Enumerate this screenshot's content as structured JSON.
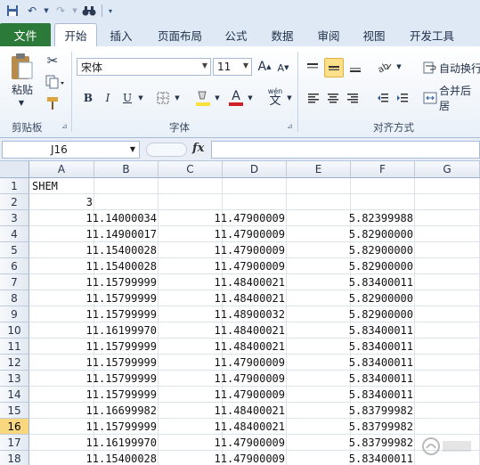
{
  "qat": {
    "items": [
      "save-icon",
      "undo-icon",
      "redo-icon",
      "binoculars-icon",
      "customize-icon"
    ]
  },
  "tabs": {
    "file": "文件",
    "items": [
      "开始",
      "插入",
      "页面布局",
      "公式",
      "数据",
      "审阅",
      "视图",
      "开发工具"
    ],
    "active": "开始"
  },
  "ribbon": {
    "clipboard": {
      "paste": "粘贴",
      "group_label": "剪贴板"
    },
    "font": {
      "font_name": "宋体",
      "font_size": "11",
      "bold": "B",
      "italic": "I",
      "underline": "U",
      "font_color_letter": "A",
      "font_color": "#d0202a",
      "fill_color": "#f7e23b",
      "wen": "wén",
      "group_label": "字体"
    },
    "alignment": {
      "wrap_text": "自动换行",
      "merge_center": "合并后居",
      "group_label": "对齐方式"
    }
  },
  "formula_bar": {
    "name_box": "J16",
    "fx": "fx",
    "formula": ""
  },
  "grid": {
    "columns": [
      "A",
      "B",
      "C",
      "D",
      "E",
      "F",
      "G"
    ],
    "selected_row": "16",
    "rows": [
      {
        "n": "1",
        "a": "SHEM",
        "c1": "",
        "c2": "",
        "c3": ""
      },
      {
        "n": "2",
        "a": "3",
        "c1": "",
        "c2": "",
        "c3": ""
      },
      {
        "n": "3",
        "a": "",
        "c1": "11.14000034",
        "c2": "11.47900009",
        "c3": "5.82399988"
      },
      {
        "n": "4",
        "a": "",
        "c1": "11.14900017",
        "c2": "11.47900009",
        "c3": "5.82900000"
      },
      {
        "n": "5",
        "a": "",
        "c1": "11.15400028",
        "c2": "11.47900009",
        "c3": "5.82900000"
      },
      {
        "n": "6",
        "a": "",
        "c1": "11.15400028",
        "c2": "11.47900009",
        "c3": "5.82900000"
      },
      {
        "n": "7",
        "a": "",
        "c1": "11.15799999",
        "c2": "11.48400021",
        "c3": "5.83400011"
      },
      {
        "n": "8",
        "a": "",
        "c1": "11.15799999",
        "c2": "11.48400021",
        "c3": "5.82900000"
      },
      {
        "n": "9",
        "a": "",
        "c1": "11.15799999",
        "c2": "11.48900032",
        "c3": "5.82900000"
      },
      {
        "n": "10",
        "a": "",
        "c1": "11.16199970",
        "c2": "11.48400021",
        "c3": "5.83400011"
      },
      {
        "n": "11",
        "a": "",
        "c1": "11.15799999",
        "c2": "11.48400021",
        "c3": "5.83400011"
      },
      {
        "n": "12",
        "a": "",
        "c1": "11.15799999",
        "c2": "11.47900009",
        "c3": "5.83400011"
      },
      {
        "n": "13",
        "a": "",
        "c1": "11.15799999",
        "c2": "11.47900009",
        "c3": "5.83400011"
      },
      {
        "n": "14",
        "a": "",
        "c1": "11.15799999",
        "c2": "11.47900009",
        "c3": "5.83400011"
      },
      {
        "n": "15",
        "a": "",
        "c1": "11.16699982",
        "c2": "11.48400021",
        "c3": "5.83799982"
      },
      {
        "n": "16",
        "a": "",
        "c1": "11.15799999",
        "c2": "11.48400021",
        "c3": "5.83799982"
      },
      {
        "n": "17",
        "a": "",
        "c1": "11.16199970",
        "c2": "11.47900009",
        "c3": "5.83799982"
      },
      {
        "n": "18",
        "a": "",
        "c1": "11.15400028",
        "c2": "11.47900009",
        "c3": "5.83400011"
      }
    ]
  }
}
